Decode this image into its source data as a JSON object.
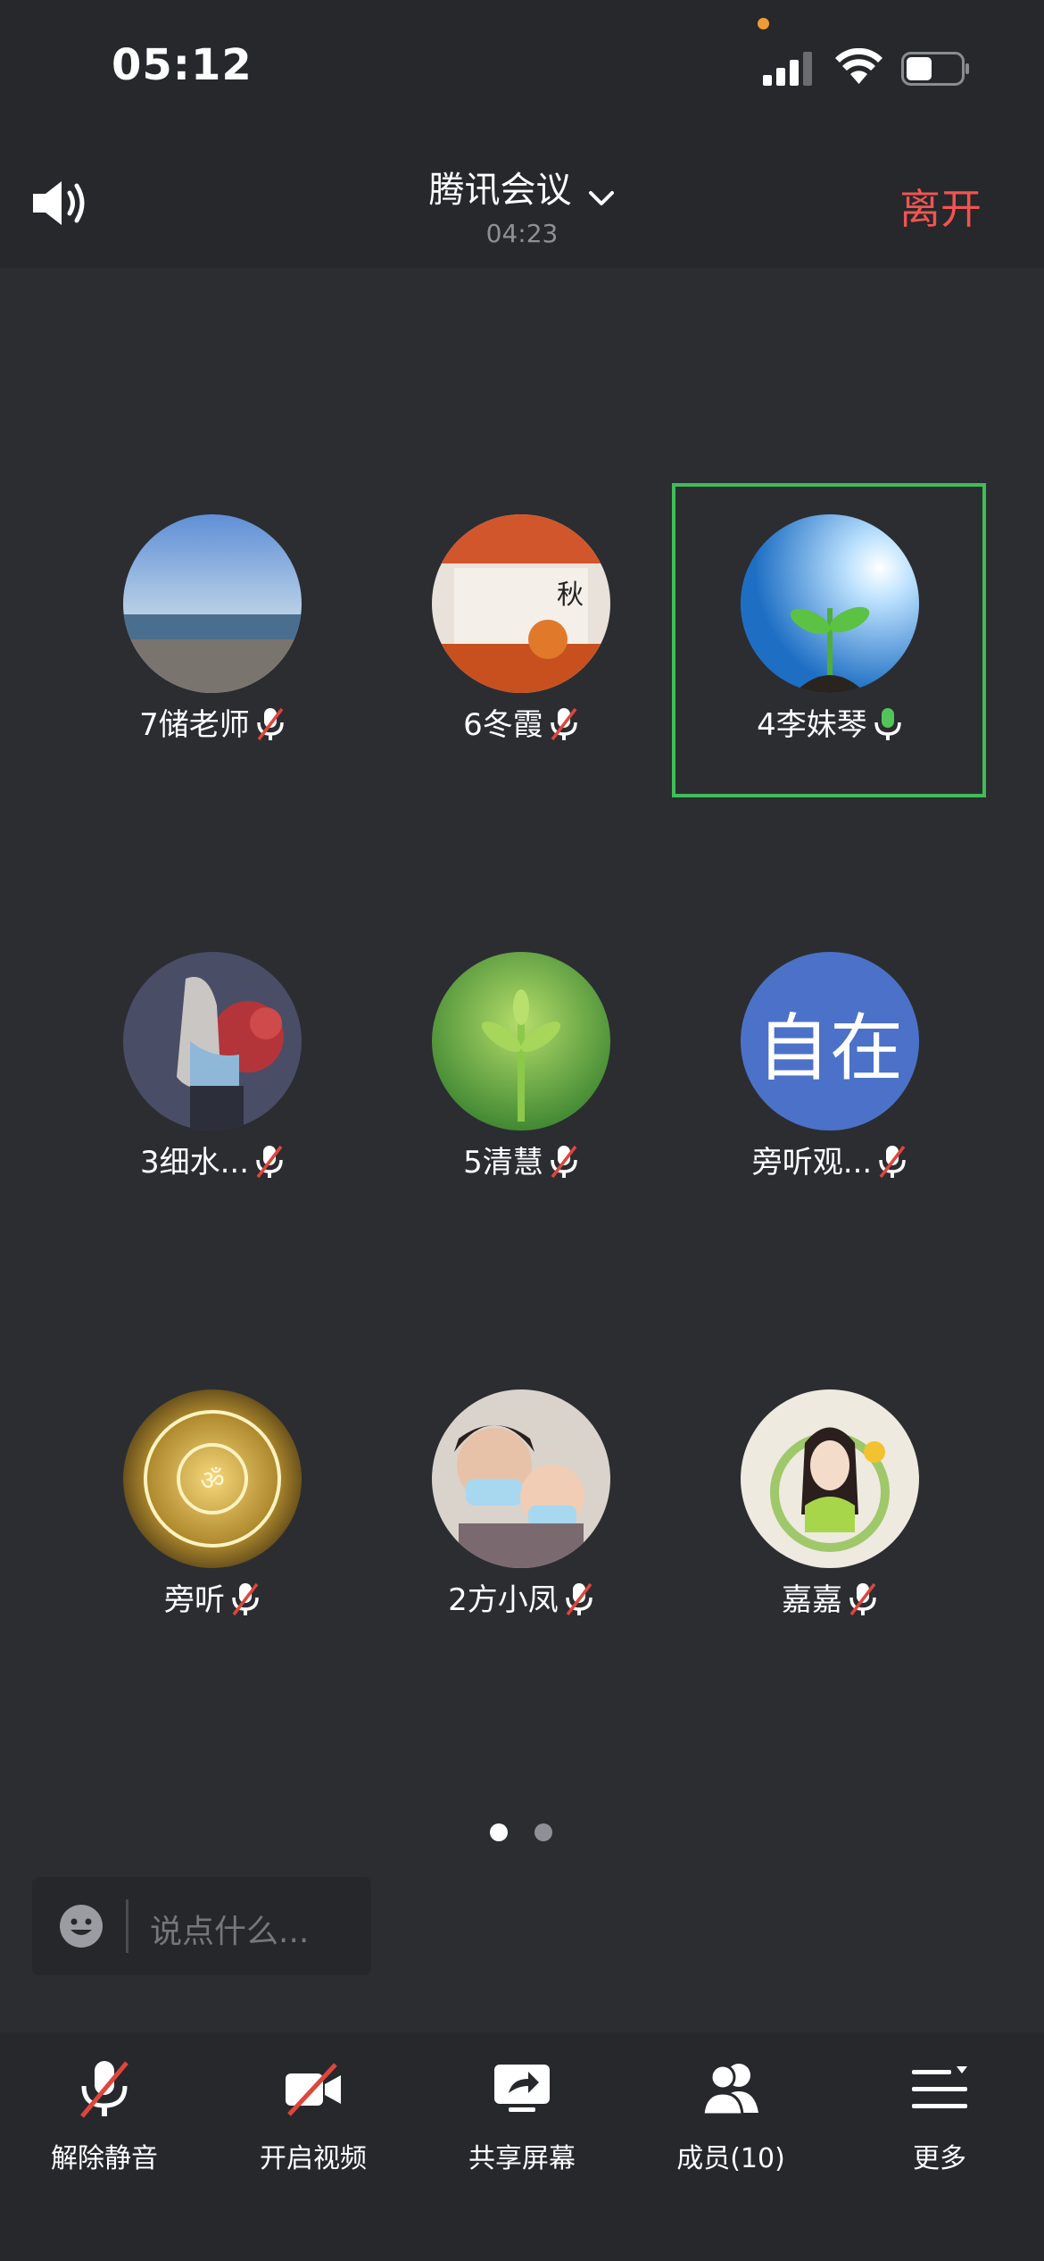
{
  "status_bar": {
    "time": "05:12"
  },
  "header": {
    "title": "腾讯会议",
    "duration": "04:23",
    "leave_label": "离开"
  },
  "participants": [
    {
      "name": "7储老师",
      "mic": "muted"
    },
    {
      "name": "6冬霞",
      "mic": "muted"
    },
    {
      "name": "4李妹琴",
      "mic": "active"
    },
    {
      "name": "3细水...",
      "mic": "muted"
    },
    {
      "name": "5清慧",
      "mic": "muted"
    },
    {
      "name": "旁听观...",
      "mic": "muted",
      "avatar_text": "自在"
    },
    {
      "name": "旁听",
      "mic": "muted"
    },
    {
      "name": "2方小凤",
      "mic": "muted"
    },
    {
      "name": "嘉嘉",
      "mic": "muted"
    }
  ],
  "pager": {
    "pages": 2,
    "current": 1
  },
  "chat": {
    "placeholder": "说点什么..."
  },
  "toolbar": {
    "unmute_label": "解除静音",
    "video_label": "开启视频",
    "share_label": "共享屏幕",
    "members_label": "成员(10)",
    "more_label": "更多"
  },
  "colors": {
    "leave": "#f25450",
    "active_frame": "#3fbd57",
    "mic_active": "#52c45a",
    "mute_slash": "#e0453c",
    "avatar_text_bg": "#4b72c8"
  }
}
